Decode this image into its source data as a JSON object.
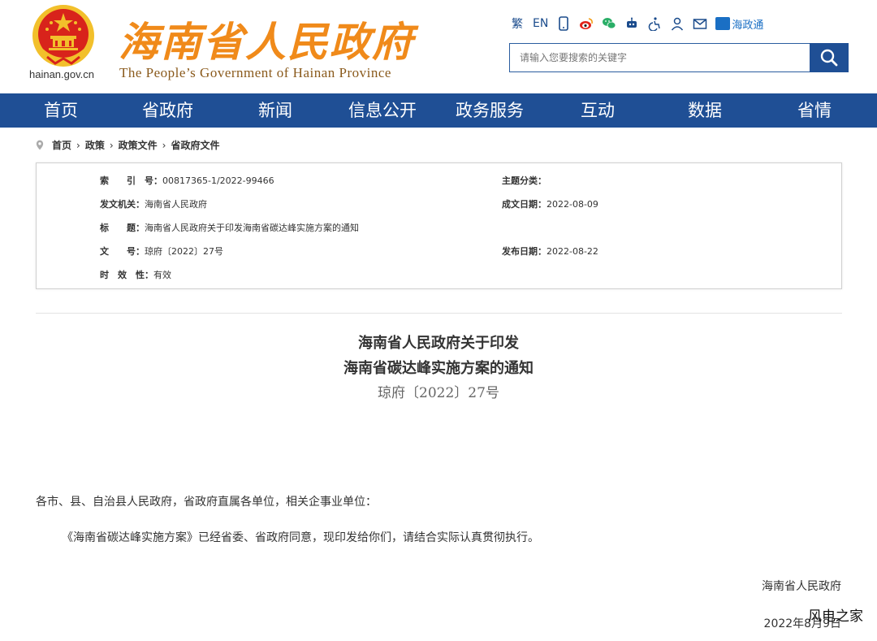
{
  "header": {
    "domain": "hainan.gov.cn",
    "title": "海南省人民政府",
    "subtitle": "The People’s Government of Hainan Province",
    "tools": {
      "traditional": "繁",
      "english": "EN",
      "hainan_app": "海政通"
    },
    "search_placeholder": "请输入您要搜索的关键字"
  },
  "nav": {
    "items": [
      "首页",
      "省政府",
      "新闻",
      "信息公开",
      "政务服务",
      "互动",
      "数据",
      "省情"
    ]
  },
  "breadcrumb": [
    "首页",
    "政策",
    "政策文件",
    "省政府文件"
  ],
  "meta": {
    "index_label": "索　　引　号：",
    "index_value": "00817365-1/2022-99466",
    "topic_label": "主题分类：",
    "topic_value": "",
    "issuer_label": "发文机关：",
    "issuer_value": "海南省人民政府",
    "written_date_label": "成文日期：",
    "written_date_value": "2022-08-09",
    "title_label": "标　　题：",
    "title_value": "海南省人民政府关于印发海南省碳达峰实施方案的通知",
    "docno_label": "文　　号：",
    "docno_value": "琼府〔2022〕27号",
    "publish_date_label": "发布日期：",
    "publish_date_value": "2022-08-22",
    "validity_label": "时　效　性：",
    "validity_value": "有效"
  },
  "document": {
    "title_line1": "海南省人民政府关于印发",
    "title_line2": "海南省碳达峰实施方案的通知",
    "number": "琼府〔2022〕27号",
    "salutation": "各市、县、自治县人民政府，省政府直属各单位，相关企事业单位：",
    "body": "《海南省碳达峰实施方案》已经省委、省政府同意，现印发给你们，请结合实际认真贯彻执行。",
    "signer": "海南省人民政府",
    "date": "2022年8月9日"
  },
  "watermark": "风电之家",
  "colors": {
    "nav_bg": "#1f4f95",
    "title_orange": "#f08a1a",
    "emblem_red": "#d8231b",
    "emblem_gold": "#f2c02b"
  }
}
